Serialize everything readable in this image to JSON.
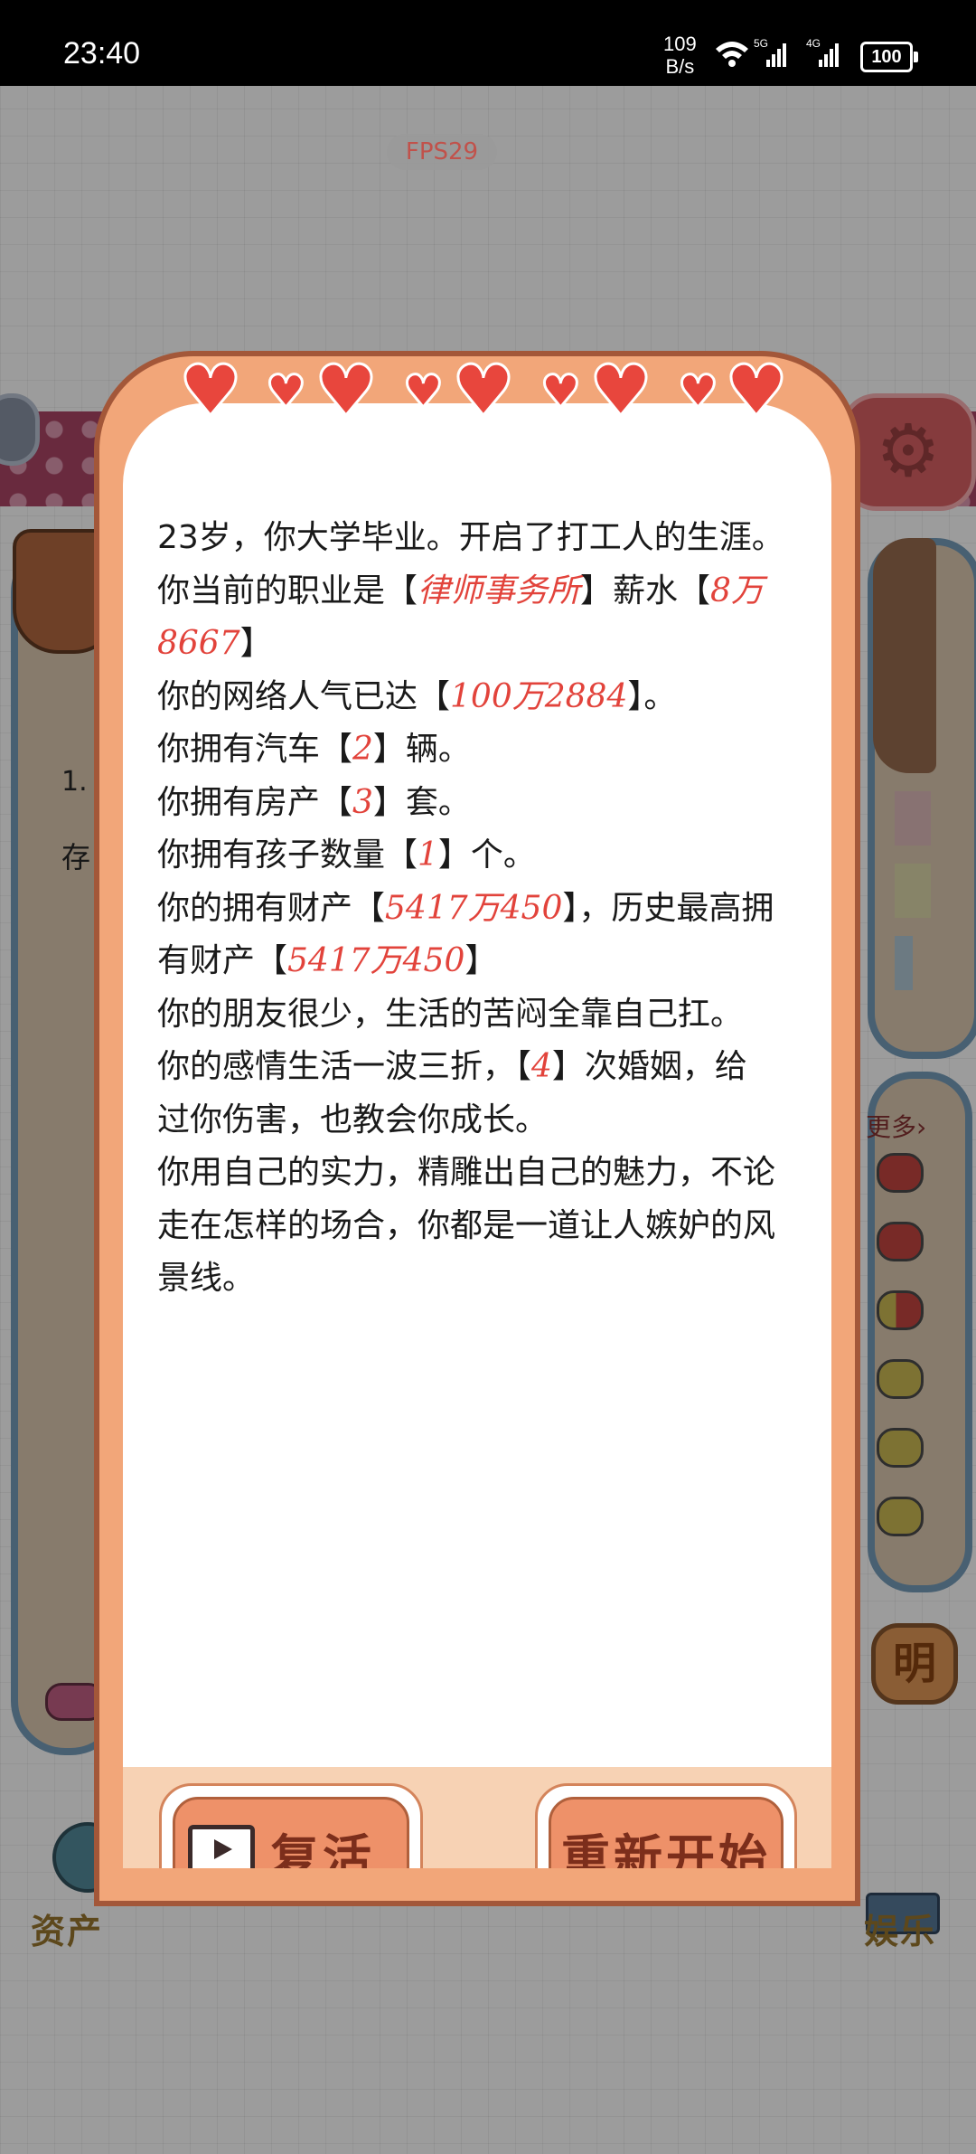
{
  "status_bar": {
    "time": "23:40",
    "speed_value": "109",
    "speed_unit": "B/s",
    "network_5g": "5G",
    "network_4g": "4G",
    "battery": "100"
  },
  "overlay": {
    "fps": "FPS29"
  },
  "background": {
    "left_label_1": "1.",
    "left_label_2": "存",
    "right_more": "更多›",
    "right_tile": "明",
    "bottom_left": "资产",
    "bottom_right": "娱乐"
  },
  "dialog": {
    "lines": [
      [
        {
          "t": "23岁，你大学毕业。开启了打工人的生涯。"
        }
      ],
      [
        {
          "t": "你当前的职业是【"
        },
        {
          "t": "律师事务所",
          "h": true
        },
        {
          "t": "】薪水【"
        },
        {
          "t": "8万",
          "h": true
        }
      ],
      [
        {
          "t": "8667",
          "h": true
        },
        {
          "t": "】"
        }
      ],
      [
        {
          "t": "你的网络人气已达【"
        },
        {
          "t": "100万2884",
          "h": true
        },
        {
          "t": "】。"
        }
      ],
      [
        {
          "t": "你拥有汽车【"
        },
        {
          "t": "2",
          "h": true
        },
        {
          "t": "】辆。"
        }
      ],
      [
        {
          "t": "你拥有房产【"
        },
        {
          "t": "3",
          "h": true
        },
        {
          "t": "】套。"
        }
      ],
      [
        {
          "t": "你拥有孩子数量【"
        },
        {
          "t": "1",
          "h": true
        },
        {
          "t": "】个。"
        }
      ],
      [
        {
          "t": "你的拥有财产【"
        },
        {
          "t": "5417万450",
          "h": true
        },
        {
          "t": "】，历史最高拥"
        }
      ],
      [
        {
          "t": "有财产【"
        },
        {
          "t": "5417万450",
          "h": true
        },
        {
          "t": "】"
        }
      ],
      [
        {
          "t": "你的朋友很少，生活的苦闷全靠自己扛。"
        }
      ],
      [
        {
          "t": "你的感情生活一波三折，【"
        },
        {
          "t": "4",
          "h": true
        },
        {
          "t": "】次婚姻，给"
        }
      ],
      [
        {
          "t": "过你伤害，也教会你成长。"
        }
      ],
      [
        {
          "t": "你用自己的实力，精雕出自己的魅力，不论"
        }
      ],
      [
        {
          "t": "走在怎样的场合，你都是一道让人嫉妒的风"
        }
      ],
      [
        {
          "t": "景线。"
        }
      ]
    ],
    "revive_label": "复活",
    "restart_label": "重新开始"
  },
  "colors": {
    "dialog_bg": "#f2a679",
    "dialog_border": "#a35739",
    "highlight": "#e2433b",
    "heart": "#e8463d",
    "button_face": "#ee9169",
    "button_text": "#7c2e1b"
  }
}
